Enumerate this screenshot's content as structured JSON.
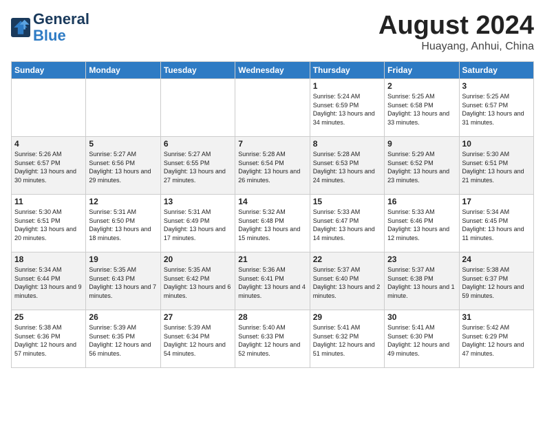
{
  "header": {
    "logo_line1": "General",
    "logo_line2": "Blue",
    "month_year": "August 2024",
    "location": "Huayang, Anhui, China"
  },
  "days_of_week": [
    "Sunday",
    "Monday",
    "Tuesday",
    "Wednesday",
    "Thursday",
    "Friday",
    "Saturday"
  ],
  "weeks": [
    [
      {
        "day": "",
        "sunrise": "",
        "sunset": "",
        "daylight": ""
      },
      {
        "day": "",
        "sunrise": "",
        "sunset": "",
        "daylight": ""
      },
      {
        "day": "",
        "sunrise": "",
        "sunset": "",
        "daylight": ""
      },
      {
        "day": "",
        "sunrise": "",
        "sunset": "",
        "daylight": ""
      },
      {
        "day": "1",
        "sunrise": "Sunrise: 5:24 AM",
        "sunset": "Sunset: 6:59 PM",
        "daylight": "Daylight: 13 hours and 34 minutes."
      },
      {
        "day": "2",
        "sunrise": "Sunrise: 5:25 AM",
        "sunset": "Sunset: 6:58 PM",
        "daylight": "Daylight: 13 hours and 33 minutes."
      },
      {
        "day": "3",
        "sunrise": "Sunrise: 5:25 AM",
        "sunset": "Sunset: 6:57 PM",
        "daylight": "Daylight: 13 hours and 31 minutes."
      }
    ],
    [
      {
        "day": "4",
        "sunrise": "Sunrise: 5:26 AM",
        "sunset": "Sunset: 6:57 PM",
        "daylight": "Daylight: 13 hours and 30 minutes."
      },
      {
        "day": "5",
        "sunrise": "Sunrise: 5:27 AM",
        "sunset": "Sunset: 6:56 PM",
        "daylight": "Daylight: 13 hours and 29 minutes."
      },
      {
        "day": "6",
        "sunrise": "Sunrise: 5:27 AM",
        "sunset": "Sunset: 6:55 PM",
        "daylight": "Daylight: 13 hours and 27 minutes."
      },
      {
        "day": "7",
        "sunrise": "Sunrise: 5:28 AM",
        "sunset": "Sunset: 6:54 PM",
        "daylight": "Daylight: 13 hours and 26 minutes."
      },
      {
        "day": "8",
        "sunrise": "Sunrise: 5:28 AM",
        "sunset": "Sunset: 6:53 PM",
        "daylight": "Daylight: 13 hours and 24 minutes."
      },
      {
        "day": "9",
        "sunrise": "Sunrise: 5:29 AM",
        "sunset": "Sunset: 6:52 PM",
        "daylight": "Daylight: 13 hours and 23 minutes."
      },
      {
        "day": "10",
        "sunrise": "Sunrise: 5:30 AM",
        "sunset": "Sunset: 6:51 PM",
        "daylight": "Daylight: 13 hours and 21 minutes."
      }
    ],
    [
      {
        "day": "11",
        "sunrise": "Sunrise: 5:30 AM",
        "sunset": "Sunset: 6:51 PM",
        "daylight": "Daylight: 13 hours and 20 minutes."
      },
      {
        "day": "12",
        "sunrise": "Sunrise: 5:31 AM",
        "sunset": "Sunset: 6:50 PM",
        "daylight": "Daylight: 13 hours and 18 minutes."
      },
      {
        "day": "13",
        "sunrise": "Sunrise: 5:31 AM",
        "sunset": "Sunset: 6:49 PM",
        "daylight": "Daylight: 13 hours and 17 minutes."
      },
      {
        "day": "14",
        "sunrise": "Sunrise: 5:32 AM",
        "sunset": "Sunset: 6:48 PM",
        "daylight": "Daylight: 13 hours and 15 minutes."
      },
      {
        "day": "15",
        "sunrise": "Sunrise: 5:33 AM",
        "sunset": "Sunset: 6:47 PM",
        "daylight": "Daylight: 13 hours and 14 minutes."
      },
      {
        "day": "16",
        "sunrise": "Sunrise: 5:33 AM",
        "sunset": "Sunset: 6:46 PM",
        "daylight": "Daylight: 13 hours and 12 minutes."
      },
      {
        "day": "17",
        "sunrise": "Sunrise: 5:34 AM",
        "sunset": "Sunset: 6:45 PM",
        "daylight": "Daylight: 13 hours and 11 minutes."
      }
    ],
    [
      {
        "day": "18",
        "sunrise": "Sunrise: 5:34 AM",
        "sunset": "Sunset: 6:44 PM",
        "daylight": "Daylight: 13 hours and 9 minutes."
      },
      {
        "day": "19",
        "sunrise": "Sunrise: 5:35 AM",
        "sunset": "Sunset: 6:43 PM",
        "daylight": "Daylight: 13 hours and 7 minutes."
      },
      {
        "day": "20",
        "sunrise": "Sunrise: 5:35 AM",
        "sunset": "Sunset: 6:42 PM",
        "daylight": "Daylight: 13 hours and 6 minutes."
      },
      {
        "day": "21",
        "sunrise": "Sunrise: 5:36 AM",
        "sunset": "Sunset: 6:41 PM",
        "daylight": "Daylight: 13 hours and 4 minutes."
      },
      {
        "day": "22",
        "sunrise": "Sunrise: 5:37 AM",
        "sunset": "Sunset: 6:40 PM",
        "daylight": "Daylight: 13 hours and 2 minutes."
      },
      {
        "day": "23",
        "sunrise": "Sunrise: 5:37 AM",
        "sunset": "Sunset: 6:38 PM",
        "daylight": "Daylight: 13 hours and 1 minute."
      },
      {
        "day": "24",
        "sunrise": "Sunrise: 5:38 AM",
        "sunset": "Sunset: 6:37 PM",
        "daylight": "Daylight: 12 hours and 59 minutes."
      }
    ],
    [
      {
        "day": "25",
        "sunrise": "Sunrise: 5:38 AM",
        "sunset": "Sunset: 6:36 PM",
        "daylight": "Daylight: 12 hours and 57 minutes."
      },
      {
        "day": "26",
        "sunrise": "Sunrise: 5:39 AM",
        "sunset": "Sunset: 6:35 PM",
        "daylight": "Daylight: 12 hours and 56 minutes."
      },
      {
        "day": "27",
        "sunrise": "Sunrise: 5:39 AM",
        "sunset": "Sunset: 6:34 PM",
        "daylight": "Daylight: 12 hours and 54 minutes."
      },
      {
        "day": "28",
        "sunrise": "Sunrise: 5:40 AM",
        "sunset": "Sunset: 6:33 PM",
        "daylight": "Daylight: 12 hours and 52 minutes."
      },
      {
        "day": "29",
        "sunrise": "Sunrise: 5:41 AM",
        "sunset": "Sunset: 6:32 PM",
        "daylight": "Daylight: 12 hours and 51 minutes."
      },
      {
        "day": "30",
        "sunrise": "Sunrise: 5:41 AM",
        "sunset": "Sunset: 6:30 PM",
        "daylight": "Daylight: 12 hours and 49 minutes."
      },
      {
        "day": "31",
        "sunrise": "Sunrise: 5:42 AM",
        "sunset": "Sunset: 6:29 PM",
        "daylight": "Daylight: 12 hours and 47 minutes."
      }
    ]
  ]
}
